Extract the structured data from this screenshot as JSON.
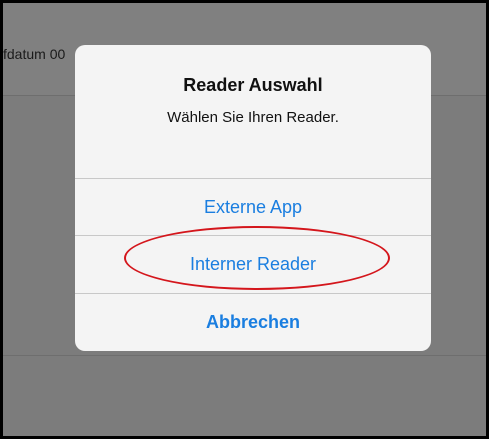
{
  "background": {
    "label": "fdatum  00"
  },
  "dialog": {
    "title": "Reader Auswahl",
    "message": "Wählen Sie Ihren Reader.",
    "actions": [
      {
        "label": "Externe App"
      },
      {
        "label": "Interner Reader"
      },
      {
        "label": "Abbrechen"
      }
    ]
  },
  "colors": {
    "accent": "#1a7ee0",
    "highlight": "#d4161c",
    "overlay": "#7c7c7c"
  }
}
